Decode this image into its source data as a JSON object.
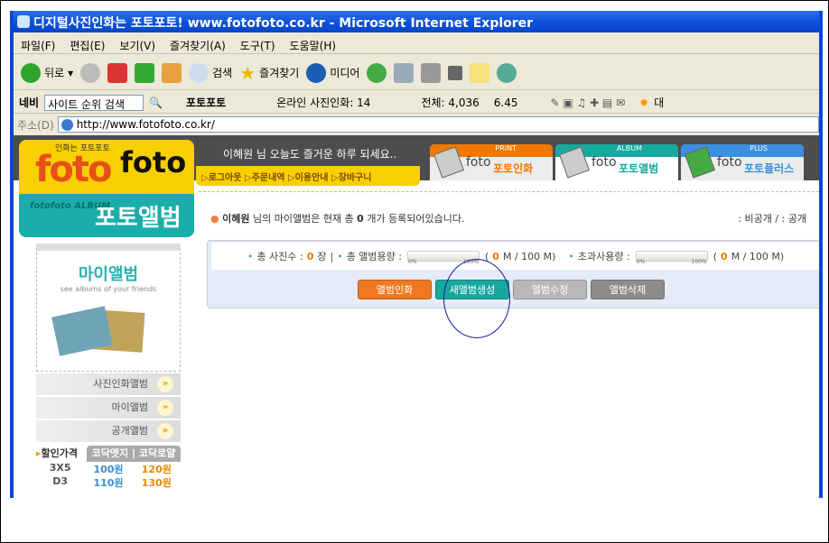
{
  "window": {
    "title": "디지털사진인화는 포토포토! www.fotofoto.co.kr - Microsoft Internet Explorer"
  },
  "menu": [
    "파일(F)",
    "편집(E)",
    "보기(V)",
    "즐겨찾기(A)",
    "도구(T)",
    "도움말(H)"
  ],
  "toolbar": {
    "back": "뒤로",
    "search": "검색",
    "favorites": "즐겨찾기",
    "media": "미디어"
  },
  "links": {
    "naver": "네비",
    "search_value": "사이트 순위 검색",
    "site": "포토포토",
    "online": "온라인 사진인화: 14",
    "total": "전체: 4,036",
    "time": "6.45",
    "more": "대"
  },
  "address": {
    "label": "주소(D)",
    "url": "http://www.fotofoto.co.kr/"
  },
  "logo": {
    "tag": "인화는 포토포토",
    "foto1": "foto",
    "foto2": "foto",
    "sub": "fotofoto ALBUM",
    "title": "포토앨범"
  },
  "greeting": {
    "text": "이혜원 님 오늘도 즐거운 하루 되세요..",
    "links": [
      "로그아웃",
      "주문내역",
      "이용안내",
      "장바구니"
    ]
  },
  "tabs": [
    {
      "hd": "PRINT",
      "name": "포토인화",
      "color": "#f07800"
    },
    {
      "hd": "ALBUM",
      "name": "포토앨범",
      "color": "#17a89e"
    },
    {
      "hd": "PLUS",
      "name": "포토플러스",
      "color": "#3a8fe0"
    }
  ],
  "status": {
    "user": "이혜원",
    "text1": " 님의 마이앨범은 현재 총 ",
    "count": "0",
    "text2": " 개가 등록되어있습니다.",
    "legend": ": 비공개 / : 공개"
  },
  "stats": {
    "photos_label": "총 사진수 :",
    "photos": "0",
    "photos_unit": "장",
    "capacity_label": "총 앨범용량 :",
    "cap_used": "0",
    "cap_rest": " M / 100 M)",
    "over_label": "초과사용량 :",
    "over_used": "0",
    "over_rest": " M / 100 M)",
    "p0": "0%",
    "p1": "100%"
  },
  "buttons": [
    "앨범인화",
    "새앨범생성",
    "앨범수정",
    "앨범삭제"
  ],
  "sidebar": {
    "promo_title": "마이앨범",
    "promo_sub": "see albums of your friends",
    "menu": [
      "사진인화앨범",
      "마이앨범",
      "공개앨범"
    ],
    "price_label": "할인가격",
    "price_tab": "코닥엣지 | 코닥로얄",
    "prices": [
      [
        "3X5",
        "100원",
        "120원"
      ],
      [
        "D3",
        "110원",
        "130원"
      ]
    ]
  }
}
